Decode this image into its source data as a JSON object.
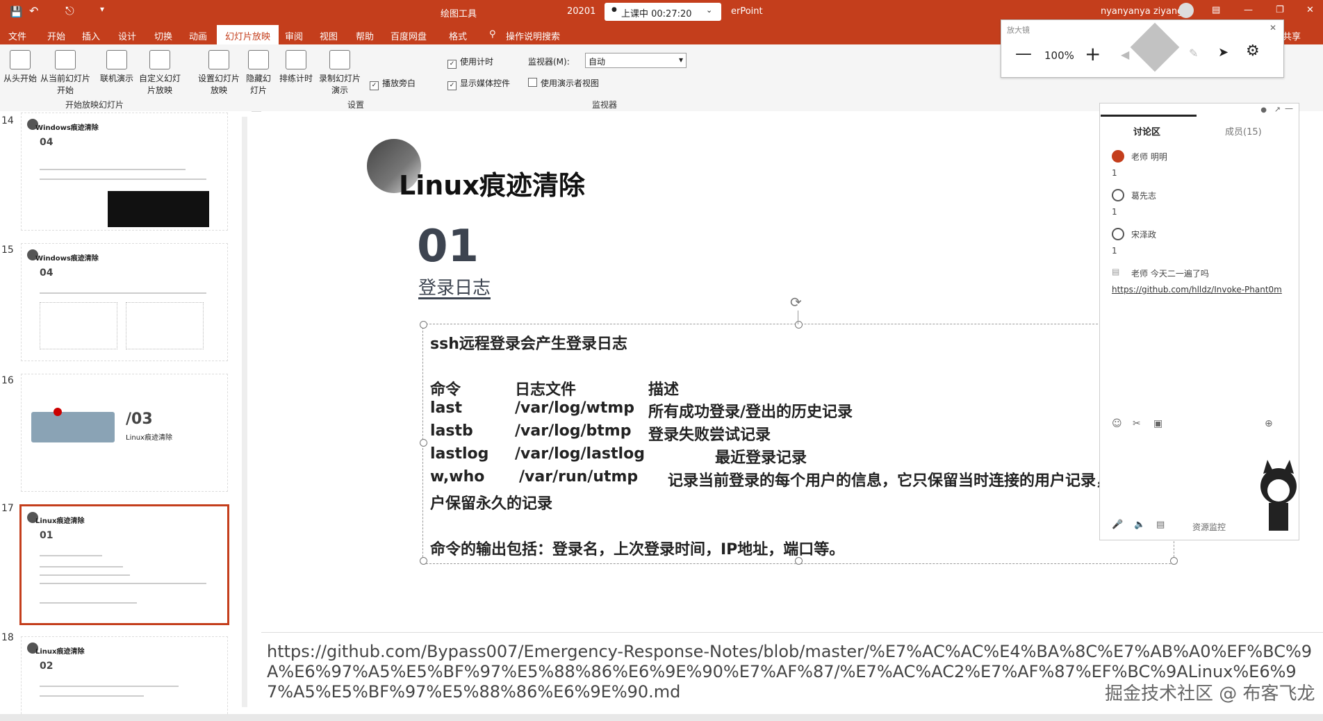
{
  "titlebar": {
    "context_tab": "绘图工具",
    "filename_prefix": "20201",
    "class_status": "上课中 00:27:20",
    "app_suffix": "erPoint",
    "user": "nyanyanya ziyang"
  },
  "tabs": [
    "文件",
    "开始",
    "插入",
    "设计",
    "切换",
    "动画",
    "幻灯片放映",
    "审阅",
    "视图",
    "帮助",
    "百度网盘",
    "格式"
  ],
  "active_tab": "幻灯片放映",
  "tellme": "操作说明搜索",
  "share": "共享",
  "ribbon": {
    "start_group": {
      "buttons": [
        "从头开始",
        "从当前幻灯片开始",
        "联机演示",
        "自定义幻灯片放映"
      ],
      "label": "开始放映幻灯片"
    },
    "setup_group": {
      "buttons": [
        "设置幻灯片放映",
        "隐藏幻灯片",
        "排练计时",
        "录制幻灯片演示"
      ],
      "checks": [
        {
          "label": "使用计时",
          "checked": true
        },
        {
          "label": "播放旁白",
          "checked": true
        },
        {
          "label": "显示媒体控件",
          "checked": true
        }
      ],
      "label": "设置"
    },
    "monitor_group": {
      "monitor_label": "监视器(M):",
      "monitor_value": "自动",
      "presenter_view": "使用演示者视图",
      "presenter_checked": false,
      "label": "监视器"
    }
  },
  "zoom": {
    "value": "100%",
    "title": "放大镜"
  },
  "thumbnails": [
    {
      "num": "14",
      "title": "Windows痕迹清除",
      "subnum": "04"
    },
    {
      "num": "15",
      "title": "Windows痕迹清除",
      "subnum": "04"
    },
    {
      "num": "16",
      "title": "Linux痕迹清除",
      "subnum": "/03"
    },
    {
      "num": "17",
      "title": "Linux痕迹清除",
      "subnum": "01"
    },
    {
      "num": "18",
      "title": "Linux痕迹清除",
      "subnum": "02"
    }
  ],
  "slide": {
    "title": "Linux痕迹清除",
    "number": "01",
    "subtitle": "登录日志",
    "intro": "ssh远程登录会产生登录日志",
    "table_header": [
      "命令",
      "日志文件",
      "描述"
    ],
    "rows": [
      {
        "cmd": "last",
        "file": "/var/log/wtmp",
        "desc": "所有成功登录/登出的历史记录"
      },
      {
        "cmd": "lastb",
        "file": "/var/log/btmp",
        "desc": "登录失败尝试记录"
      },
      {
        "cmd": "lastlog",
        "file": "/var/log/lastlog",
        "desc": "最近登录记录"
      },
      {
        "cmd": "w,who",
        "file": "/var/run/utmp",
        "desc": "记录当前登录的每个用户的信息，它只保留当时连接的用户记录，"
      }
    ],
    "wrap_line": "户保留永久的记录",
    "output": "命令的输出包括：登录名，上次登录时间，IP地址，端口等。"
  },
  "notes": "https://github.com/Bypass007/Emergency-Response-Notes/blob/master/%E7%AC%AC%E4%BA%8C%E7%AB%A0%EF%BC%9A%E6%97%A5%E5%BF%97%E5%88%86%E6%9E%90%E7%AF%87/%E7%AC%AC2%E7%AF%87%EF%BC%9ALinux%E6%97%A5%E5%BF%97%E5%88%86%E6%9E%90.md",
  "watermark": "掘金技术社区 @ 布客飞龙",
  "chat": {
    "tabs": [
      "讨论区",
      "成员(15)"
    ],
    "messages": [
      {
        "name": "老师 明明",
        "count": "1"
      },
      {
        "name": "葛先志",
        "count": "1"
      },
      {
        "name": "宋泽政",
        "count": "1"
      },
      {
        "name": "老师 今天二一遍了吗",
        "link": "https://github.com/hlldz/Invoke-Phant0m"
      }
    ],
    "footer": "资源监控"
  }
}
